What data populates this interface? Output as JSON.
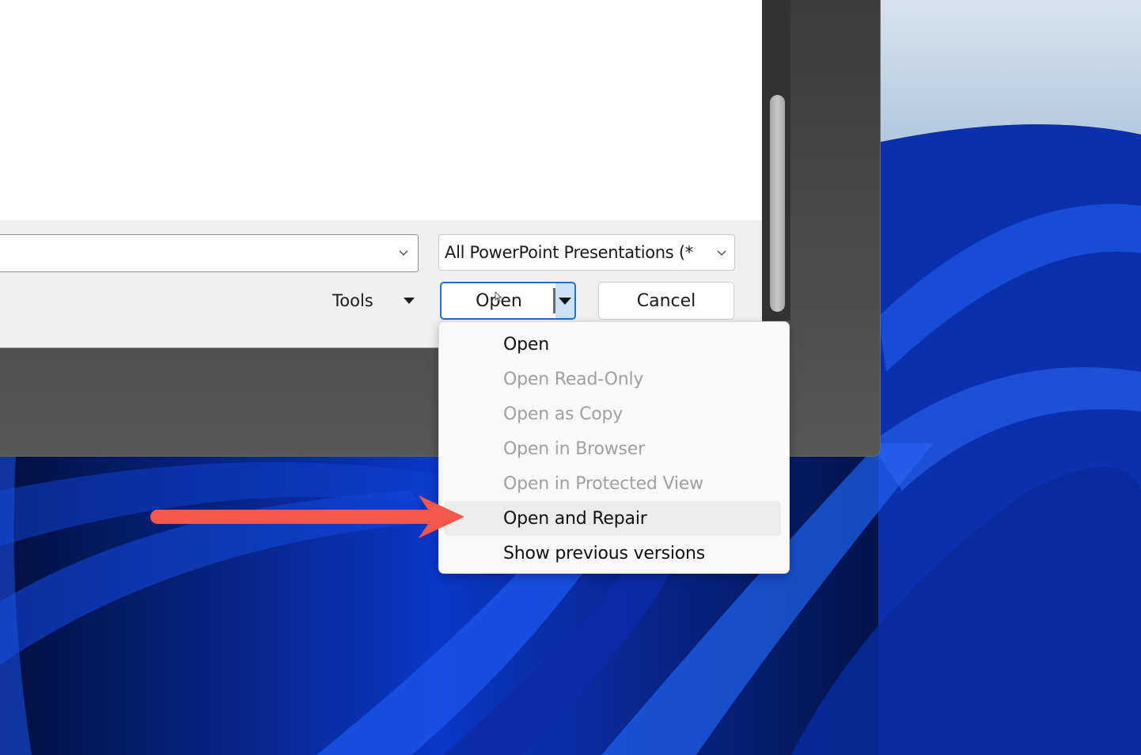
{
  "dialog": {
    "filename_value": "",
    "filetype_filter": "All PowerPoint Presentations (*",
    "tools_label": "Tools",
    "open_label": "Open",
    "cancel_label": "Cancel"
  },
  "open_menu": {
    "items": [
      {
        "label": "Open",
        "enabled": true
      },
      {
        "label": "Open Read-Only",
        "enabled": false
      },
      {
        "label": "Open as Copy",
        "enabled": false
      },
      {
        "label": "Open in Browser",
        "enabled": false
      },
      {
        "label": "Open in Protected View",
        "enabled": false
      },
      {
        "label": "Open and Repair",
        "enabled": true,
        "highlighted": true
      },
      {
        "label": "Show previous versions",
        "enabled": true
      }
    ]
  },
  "annotation": {
    "arrow_color": "#f4574b",
    "points_to": "Open and Repair"
  },
  "colors": {
    "accent": "#1f6fc7",
    "split_drop_bg": "#cce1f6",
    "disabled_text": "#a0a0a0"
  }
}
